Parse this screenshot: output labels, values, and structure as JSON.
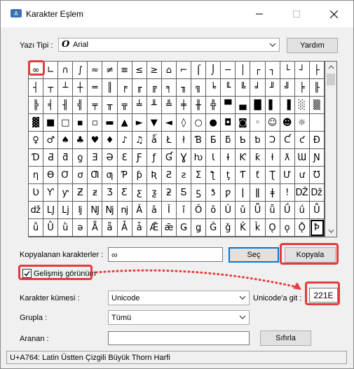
{
  "window": {
    "title": "Karakter Eşlem",
    "min_label": "─",
    "max_label": "☐",
    "close_label": "✕"
  },
  "font_row": {
    "label": "Yazı Tipi :",
    "font_glyph": "O",
    "font_value": "Arial",
    "help_button": "Yardım"
  },
  "grid": {
    "rows": [
      [
        "∞",
        "∟",
        "∩",
        "∫",
        "≈",
        "≠",
        "≡",
        "≤",
        "≥",
        "⌂",
        "⌐",
        "⌠",
        "⌡",
        "─",
        "│",
        "┌",
        "┐",
        "└",
        "┘",
        "├"
      ],
      [
        "┤",
        "┬",
        "┴",
        "┼",
        "═",
        "║",
        "╒",
        "╓",
        "╔",
        "╕",
        "╖",
        "╗",
        "╘",
        "╙",
        "╚",
        "╛",
        "╜",
        "╝",
        "╞",
        "╟"
      ],
      [
        "╠",
        "╡",
        "╢",
        "╣",
        "╤",
        "╥",
        "╦",
        "╧",
        "╨",
        "╩",
        "╪",
        "╫",
        "╬",
        "▀",
        "▄",
        "█",
        "▌",
        "▐",
        "░",
        "▒"
      ],
      [
        "▓",
        "■",
        "□",
        "▪",
        "▫",
        "▬",
        "▲",
        "►",
        "▼",
        "◄",
        "◊",
        "○",
        "●",
        "◘",
        "◙",
        "◦",
        "☺",
        "☻",
        "☼",
        ""
      ],
      [
        "♀",
        "♂",
        "♠",
        "♣",
        "♥",
        "♦",
        "♪",
        "♫",
        "ǻ",
        "Ł",
        "ł",
        "Ɓ",
        "Ƃ",
        "ƃ",
        "Ƅ",
        "ƅ",
        "Ɔ",
        "Ƈ",
        "ƈ",
        "Ɖ"
      ],
      [
        "Ɗ",
        "Ƌ",
        "ƌ",
        "ƍ",
        "Ǝ",
        "Ə",
        "Ɛ",
        "Ƒ",
        "ƒ",
        "Ɠ",
        "Ɣ",
        "ƕ",
        "Ɩ",
        "Ɨ",
        "Ƙ",
        "ƙ",
        "ƚ",
        "ƛ",
        "Ɯ",
        "Ɲ"
      ],
      [
        "ƞ",
        "Ɵ",
        "Ơ",
        "ơ",
        "Ƣ",
        "ƣ",
        "Ƥ",
        "ƥ",
        "Ʀ",
        "Ƨ",
        "ƨ",
        "Ʃ",
        "ƪ",
        "ƫ",
        "Ƭ",
        "ƭ",
        "Ʈ",
        "Ư",
        "ư",
        "Ʊ"
      ],
      [
        "Ʋ",
        "Ƴ",
        "ƴ",
        "Ƶ",
        "ƶ",
        "Ʒ",
        "Ƹ",
        "ƹ",
        "ƺ",
        "ƻ",
        "Ƽ",
        "ƽ",
        "ƾ",
        "ƿ",
        "ǀ",
        "ǁ",
        "ǂ",
        "ǃ",
        "Ǆ",
        "ǅ"
      ],
      [
        "ǆ",
        "Ǉ",
        "ǈ",
        "ǉ",
        "Ǌ",
        "ǋ",
        "ǌ",
        "Ǎ",
        "ǎ",
        "Ǐ",
        "ǐ",
        "Ǒ",
        "ǒ",
        "Ǔ",
        "ǔ",
        "Ǖ",
        "ǖ",
        "Ǘ",
        "ǘ",
        "Ǚ"
      ],
      [
        "ǚ",
        "Ǜ",
        "ǜ",
        "ǝ",
        "Ǟ",
        "ǟ",
        "Ǡ",
        "ǡ",
        "Ǣ",
        "ǣ",
        "Ǥ",
        "ǥ",
        "Ǧ",
        "ǧ",
        "Ǩ",
        "ǩ",
        "Ǫ",
        "ǫ",
        "Ǭ",
        "Ꝥ"
      ]
    ],
    "selected_row": 9,
    "selected_col": 19
  },
  "copy_row": {
    "label": "Kopyalanan karakterler :",
    "value": "∞",
    "select_button": "Seç",
    "copy_button": "Kopyala"
  },
  "advanced": {
    "label": "Gelişmiş görünüm",
    "checked": true,
    "check_glyph": "✓"
  },
  "charset": {
    "label": "Karakter kümesi :",
    "value": "Unicode",
    "goto_label": "Unicode'a git :",
    "goto_value": "221E"
  },
  "group": {
    "label": "Grupla :",
    "value": "Tümü"
  },
  "search": {
    "label": "Aranan :",
    "value": "",
    "button": "Sıfırla"
  },
  "status": {
    "text": "U+A764: Latin Üstten Çizgili Büyük Thorn Harfi"
  },
  "colors": {
    "highlight": "#e53b3b",
    "accent": "#0078d7"
  }
}
